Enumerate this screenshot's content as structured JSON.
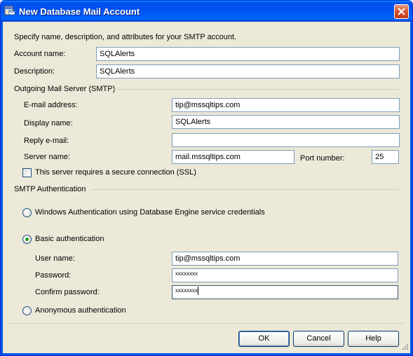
{
  "window": {
    "title": "New Database Mail Account"
  },
  "intro": "Specify name, description, and attributes for your SMTP account.",
  "account": {
    "name_label": "Account name:",
    "name_value": "SQLAlerts",
    "description_label": "Description:",
    "description_value": "SQLAlerts"
  },
  "smtp": {
    "group_label": "Outgoing Mail Server (SMTP)",
    "email_label": "E-mail address:",
    "email_value": "tip@mssqltips.com",
    "display_label": "Display name:",
    "display_value": "SQLAlerts",
    "reply_label": "Reply e-mail:",
    "reply_value": "",
    "server_label": "Server name:",
    "server_value": "mail.mssqltips.com",
    "port_label": "Port number:",
    "port_value": "25",
    "ssl_label": "This server requires a secure connection (SSL)",
    "ssl_checked": false
  },
  "auth": {
    "group_label": "SMTP Authentication",
    "windows_label": "Windows Authentication using Database Engine service credentials",
    "basic_label": "Basic authentication",
    "selected": "basic",
    "user_label": "User name:",
    "user_value": "tip@mssqltips.com",
    "password_label": "Password:",
    "password_value": "xxxxxxxx",
    "confirm_label": "Confirm password:",
    "confirm_value": "xxxxxxxx",
    "anonymous_label": "Anonymous authentication"
  },
  "buttons": {
    "ok": "OK",
    "cancel": "Cancel",
    "help": "Help"
  }
}
